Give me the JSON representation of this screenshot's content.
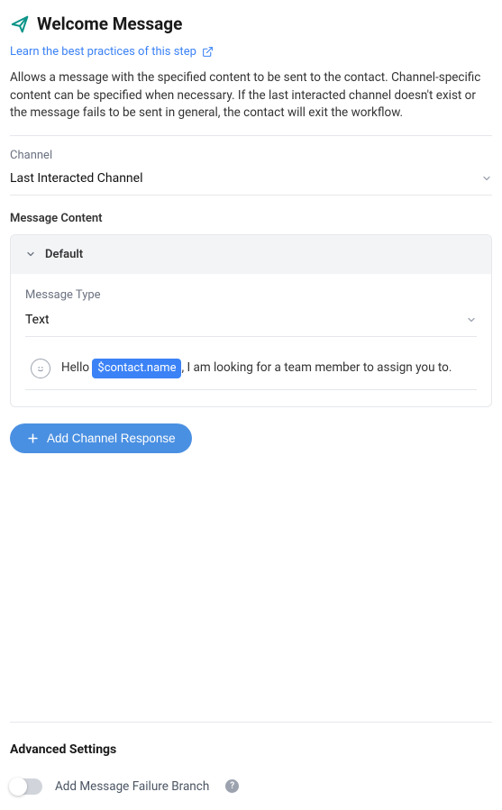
{
  "header": {
    "title": "Welcome Message",
    "learnLink": "Learn the best practices of this step",
    "description": "Allows a message with the specified content to be sent to the contact. Channel-specific content can be specified when necessary. If the last interacted channel doesn't exist or the message fails to be sent in general, the contact will exit the workflow."
  },
  "channel": {
    "label": "Channel",
    "value": "Last Interacted Channel"
  },
  "messageContent": {
    "label": "Message Content",
    "collapseTitle": "Default",
    "messageType": {
      "label": "Message Type",
      "value": "Text"
    },
    "message": {
      "prefix": "Hello ",
      "variable": "$contact.name",
      "suffix": ", I am looking for a team member to assign you to."
    }
  },
  "addChannelButton": "Add Channel Response",
  "advanced": {
    "title": "Advanced Settings",
    "failureBranch": {
      "label": "Add Message Failure Branch",
      "enabled": false
    }
  }
}
